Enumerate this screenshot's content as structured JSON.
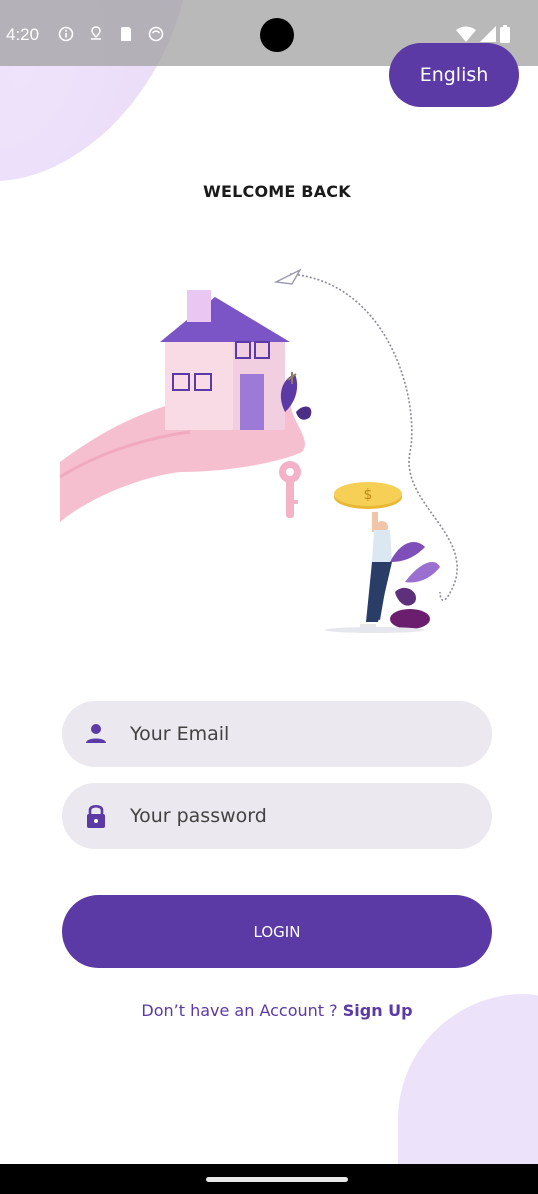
{
  "status_bar": {
    "time": "4:20",
    "left_icons": [
      "info-icon",
      "location-pin-icon",
      "sd-card-icon",
      "cloud-icon"
    ],
    "right_icons": [
      "wifi-icon",
      "signal-icon",
      "battery-icon"
    ]
  },
  "header": {
    "language_label": "English"
  },
  "main": {
    "title": "WELCOME BACK",
    "email_placeholder": "Your Email",
    "password_placeholder": "Your password",
    "login_label": "LOGIN",
    "signup_prompt": "Don’t have an Account ? ",
    "signup_link": "Sign Up"
  },
  "colors": {
    "primary": "#5b3aa6",
    "field_background": "#ebe8ef",
    "blob": "#ece2f9"
  }
}
